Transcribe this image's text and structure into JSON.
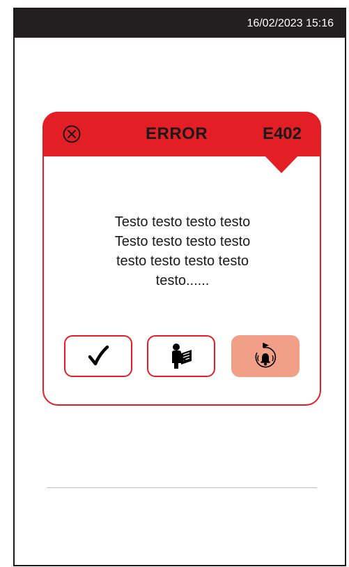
{
  "status_bar": {
    "datetime": "16/02/2023 15:16",
    "background_color": "#231f20"
  },
  "dialog": {
    "title": "ERROR",
    "code": "E402",
    "message_lines": [
      "Testo testo testo testo",
      "Testo testo testo testo",
      "testo testo testo testo",
      "testo......"
    ],
    "accent_color": "#e31e24",
    "close_icon": "close-circle-icon",
    "buttons": [
      {
        "name": "confirm-button",
        "icon": "checkmark-icon"
      },
      {
        "name": "manual-button",
        "icon": "reading-person-icon"
      },
      {
        "name": "alarm-button",
        "icon": "bell-rotate-icon",
        "fill_color": "#f19f87"
      }
    ]
  }
}
